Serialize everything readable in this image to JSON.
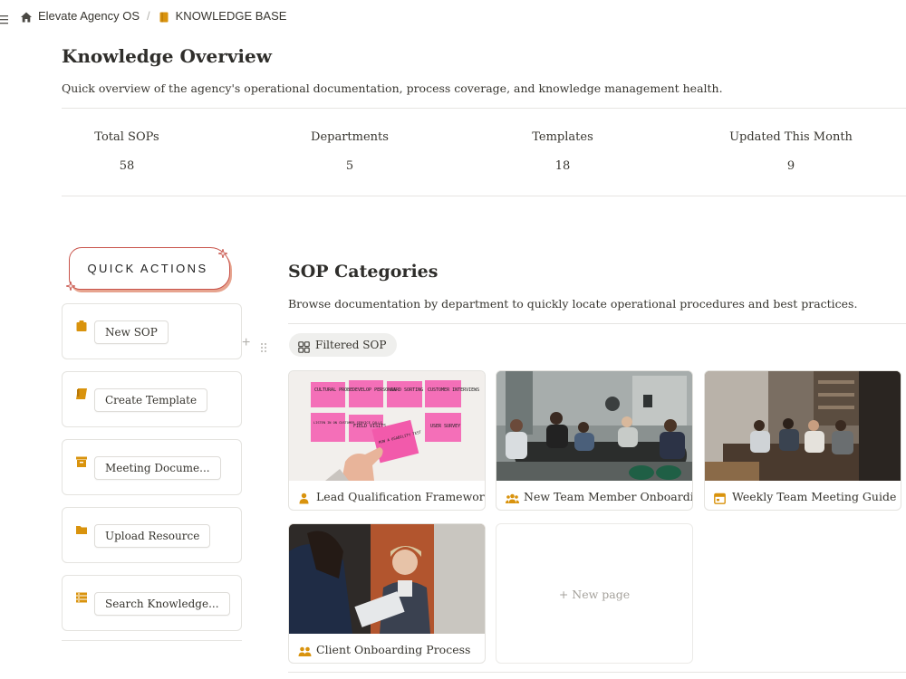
{
  "breadcrumb": {
    "workspace": "Elevate Agency OS",
    "separator": "/",
    "page": "KNOWLEDGE BASE"
  },
  "header": {
    "title": "Knowledge Overview",
    "description": "Quick overview of the agency's operational documentation, process coverage, and knowledge management health."
  },
  "stats": [
    {
      "label": "Total SOPs",
      "value": "58"
    },
    {
      "label": "Departments",
      "value": "5"
    },
    {
      "label": "Templates",
      "value": "18"
    },
    {
      "label": "Updated This Month",
      "value": "9"
    }
  ],
  "quick_actions": {
    "title": "QUICK ACTIONS",
    "items": [
      {
        "label": "New SOP",
        "icon": "clipboard-icon"
      },
      {
        "label": "Create Template",
        "icon": "scroll-icon"
      },
      {
        "label": "Meeting Docume...",
        "icon": "archive-icon"
      },
      {
        "label": "Upload Resource",
        "icon": "folder-icon"
      },
      {
        "label": "Search Knowledge...",
        "icon": "list-icon"
      }
    ]
  },
  "sop": {
    "title": "SOP Categories",
    "description": "Browse documentation by department to quickly locate operational procedures and best practices.",
    "filter_label": "Filtered SOP",
    "cards": [
      {
        "title": "Lead Qualification Framework",
        "icon": "person-icon"
      },
      {
        "title": "New Team Member Onboarding",
        "icon": "people-group-icon"
      },
      {
        "title": "Weekly Team Meeting Guide",
        "icon": "calendar-icon"
      },
      {
        "title": "Client Onboarding Process",
        "icon": "two-people-icon"
      }
    ],
    "new_page_label": "+ New page",
    "sticky_notes": [
      "CULTURAL PROBE",
      "DEVELOP PERSONAS",
      "CARD SORTING",
      "CUSTOMER INTERVIEWS",
      "LISTEN IN ON CUSTOMER SERVICE CALLS",
      "FIELD VISITS",
      "USER SURVEY",
      "RUN A USABILITY TEST"
    ]
  },
  "colors": {
    "accent": "#d9930d",
    "badge_border": "#c8534a",
    "text": "#37352f",
    "divider": "#e6e5e2"
  }
}
